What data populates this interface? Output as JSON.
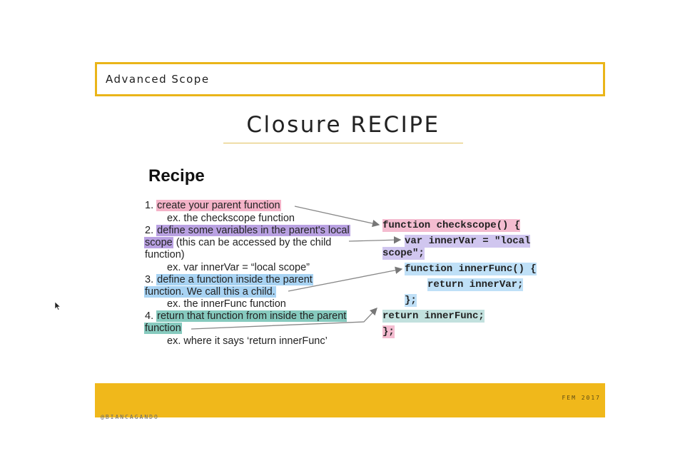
{
  "header": {
    "title": "Advanced Scope"
  },
  "slide_title": "Closure RECIPE",
  "recipe": {
    "heading": "Recipe",
    "lines": [
      {
        "prefix": "1. ",
        "highlight": "create your parent function",
        "suffix": ""
      },
      {
        "prefix": "",
        "highlight": "",
        "suffix": "ex. the checkscope function"
      },
      {
        "prefix": "2. ",
        "highlight": "define some variables in the parent's local",
        "suffix": ""
      },
      {
        "prefix": "",
        "highlight": "scope",
        "suffix": " (this can be accessed by the child"
      },
      {
        "prefix": "",
        "highlight": "",
        "suffix": "function)"
      },
      {
        "prefix": "",
        "highlight": "",
        "suffix": "ex. var innerVar = “local scope”"
      },
      {
        "prefix": "3. ",
        "highlight": "define a function inside the parent",
        "suffix": ""
      },
      {
        "prefix": "",
        "highlight": "function. We call this a child.",
        "suffix": ""
      },
      {
        "prefix": "",
        "highlight": "",
        "suffix": "ex. the innerFunc function"
      },
      {
        "prefix": "4. ",
        "highlight": "return that function from inside the parent",
        "suffix": ""
      },
      {
        "prefix": "",
        "highlight": "function",
        "suffix": ""
      },
      {
        "prefix": "",
        "highlight": "",
        "suffix": "ex. where it says ‘return innerFunc’"
      }
    ]
  },
  "code": [
    "function checkscope() {",
    "var innerVar = \"local",
    "scope\";",
    "function innerFunc() {",
    "return innerVar;",
    "};",
    "return innerFunc;",
    "};"
  ],
  "footer": {
    "right_text": "FEM 2017",
    "left_text": "@BIANCAGANDO"
  },
  "colors": {
    "accent": "#f0b81b",
    "highlight_pink": "#f4b3c8",
    "highlight_purple": "#b9a1e2",
    "highlight_blue": "#a8d3f3",
    "highlight_teal": "#86cabe"
  }
}
